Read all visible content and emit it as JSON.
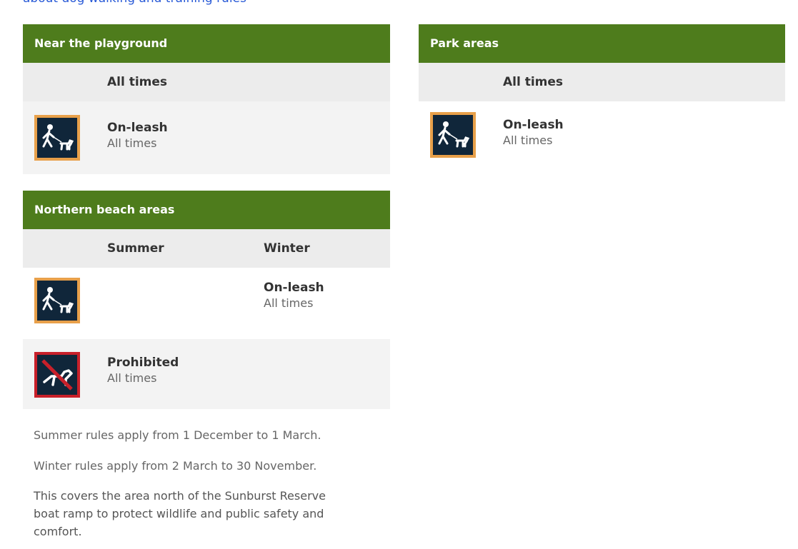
{
  "top_link": {
    "text": "about dog walking and training rules"
  },
  "cards": {
    "playground": {
      "title": "Near the playground",
      "columns": [
        "All times"
      ],
      "rule": {
        "icon": "on-leash-icon",
        "title": "On-leash",
        "sub": "All times"
      }
    },
    "park": {
      "title": "Park areas",
      "columns": [
        "All times"
      ],
      "rule": {
        "icon": "on-leash-icon",
        "title": "On-leash",
        "sub": "All times"
      }
    },
    "beach": {
      "title": "Northern beach areas",
      "columns": [
        "Summer",
        "Winter"
      ],
      "rules": [
        {
          "icon": "on-leash-icon",
          "summer": "",
          "winter_title": "On-leash",
          "winter_sub": "All times"
        },
        {
          "icon": "dogs-prohibited-icon",
          "summer_title": "Prohibited",
          "summer_sub": "All times"
        }
      ]
    }
  },
  "notes": [
    "Summer rules apply from 1 December to 1 March.",
    "Winter rules apply from 2 March to 30 November.",
    "This covers the area north of the Sunburst Reserve",
    "boat ramp to protect wildlife and public safety and",
    "comfort."
  ],
  "colors": {
    "header_green": "#4e7c1c",
    "column_grey": "#ececec",
    "on_leash_border": "#e8a04a",
    "prohibited_border": "#c8202a",
    "icon_bg": "#10263a"
  }
}
